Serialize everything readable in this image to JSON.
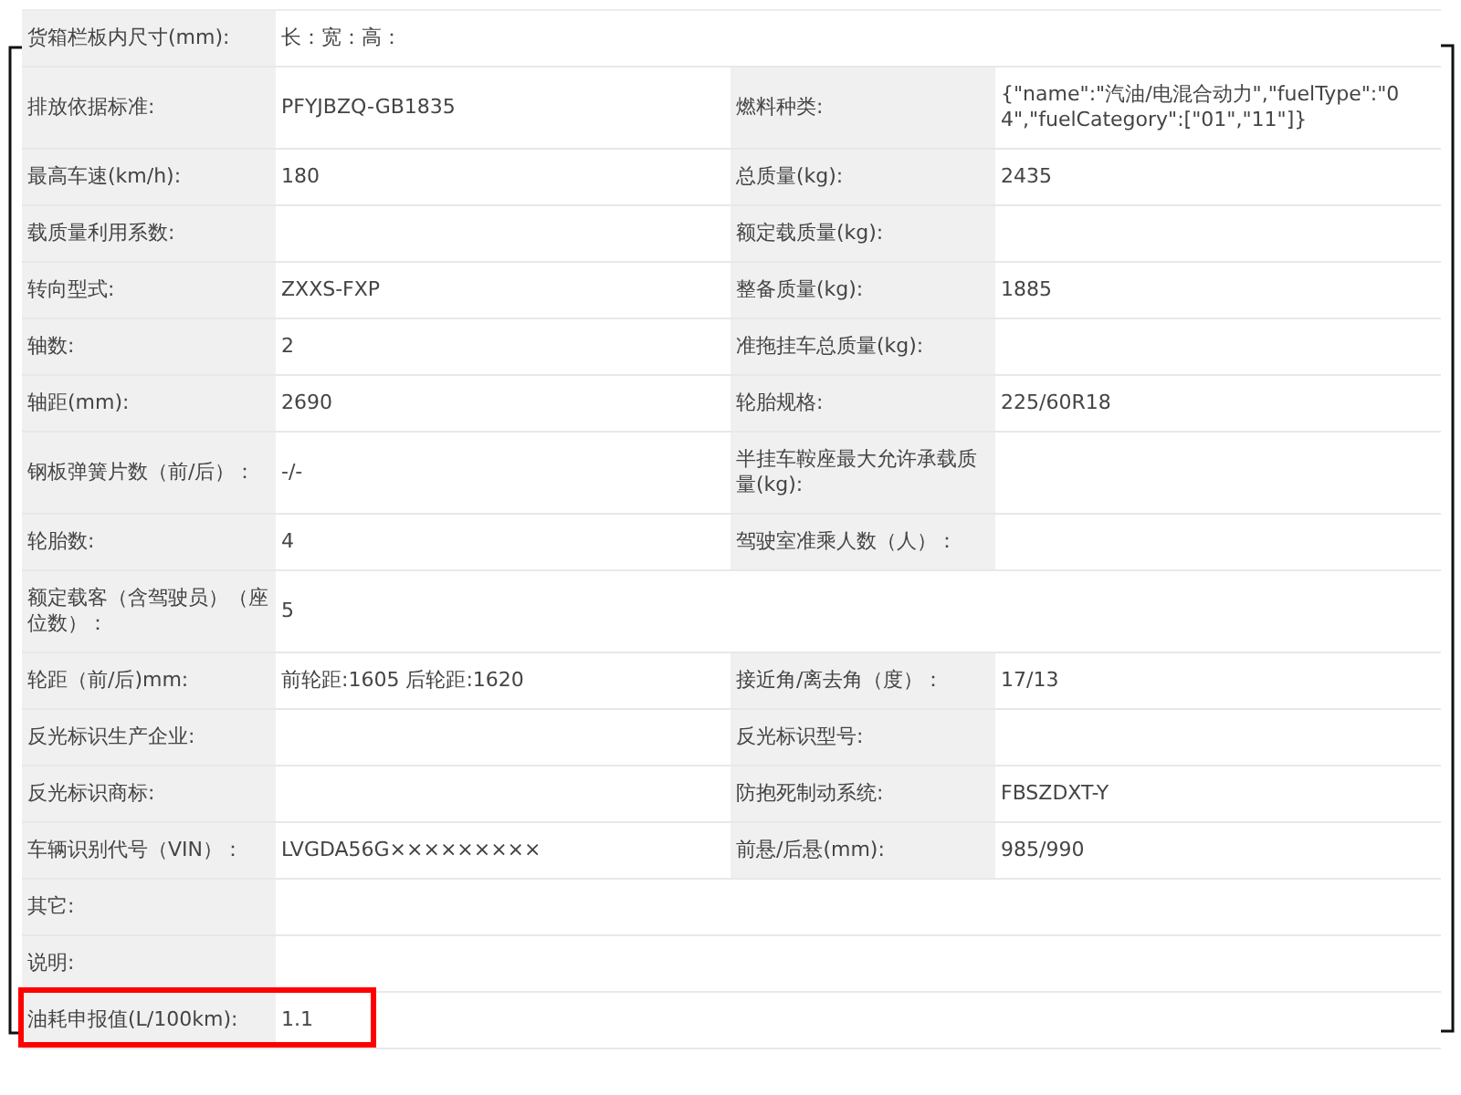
{
  "spec_table": {
    "rows": [
      {
        "highlighted": false,
        "cells": [
          {
            "label": "货箱栏板内尺寸(mm):",
            "value": "长：宽：高："
          }
        ]
      },
      {
        "highlighted": false,
        "cells": [
          {
            "label": "排放依据标准:",
            "value": "PFYJBZQ-GB1835"
          },
          {
            "label": "燃料种类:",
            "value": "{\"name\":\"汽油/电混合动力\",\"fuelType\":\"04\",\"fuelCategory\":[\"01\",\"11\"]}"
          }
        ]
      },
      {
        "highlighted": false,
        "cells": [
          {
            "label": "最高车速(km/h):",
            "value": "180"
          },
          {
            "label": "总质量(kg):",
            "value": "2435"
          }
        ]
      },
      {
        "highlighted": false,
        "cells": [
          {
            "label": "载质量利用系数:"
          },
          {
            "label": "额定载质量(kg):"
          }
        ]
      },
      {
        "highlighted": false,
        "cells": [
          {
            "label": "转向型式:",
            "value": "ZXXS-FXP"
          },
          {
            "label": "整备质量(kg):",
            "value": "1885"
          }
        ]
      },
      {
        "highlighted": false,
        "cells": [
          {
            "label": "轴数:",
            "value": "2"
          },
          {
            "label": "准拖挂车总质量(kg):"
          }
        ]
      },
      {
        "highlighted": false,
        "cells": [
          {
            "label": "轴距(mm):",
            "value": "2690"
          },
          {
            "label": "轮胎规格:",
            "value": "225/60R18"
          }
        ]
      },
      {
        "highlighted": false,
        "cells": [
          {
            "label": "钢板弹簧片数（前/后）：",
            "value": "-/-"
          },
          {
            "label": "半挂车鞍座最大允许承载质量(kg):"
          }
        ]
      },
      {
        "highlighted": false,
        "cells": [
          {
            "label": "轮胎数:",
            "value": "4"
          },
          {
            "label": "驾驶室准乘人数（人）："
          }
        ]
      },
      {
        "highlighted": false,
        "cells": [
          {
            "label": "额定载客（含驾驶员）（座位数）：",
            "value": "5"
          }
        ]
      },
      {
        "highlighted": false,
        "cells": [
          {
            "label": "轮距（前/后)mm:",
            "value": "前轮距:1605 后轮距:1620"
          },
          {
            "label": "接近角/离去角（度）：",
            "value": "17/13"
          }
        ]
      },
      {
        "highlighted": false,
        "cells": [
          {
            "label": "反光标识生产企业:"
          },
          {
            "label": "反光标识型号:"
          }
        ]
      },
      {
        "highlighted": false,
        "cells": [
          {
            "label": "反光标识商标:"
          },
          {
            "label": "防抱死制动系统:",
            "value": "FBSZDXT-Y"
          }
        ]
      },
      {
        "highlighted": false,
        "cells": [
          {
            "label": "车辆识别代号（VIN）：",
            "value": "LVGDA56G×××××××××"
          },
          {
            "label": "前悬/后悬(mm):",
            "value": "985/990"
          }
        ]
      },
      {
        "highlighted": false,
        "cells": [
          {
            "label": "其它:"
          }
        ]
      },
      {
        "highlighted": false,
        "cells": [
          {
            "label": "说明:"
          }
        ]
      },
      {
        "highlighted": true,
        "cells": [
          {
            "label": "油耗申报值(L/100km):",
            "value": "1.1"
          }
        ]
      }
    ]
  }
}
